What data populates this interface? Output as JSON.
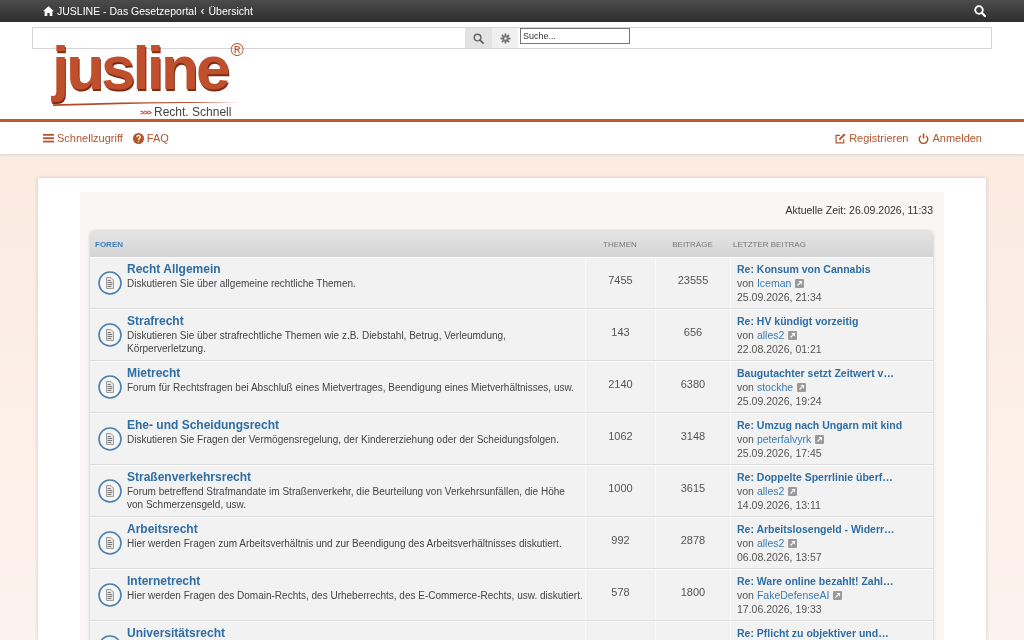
{
  "topbar": {
    "breadcrumbs": [
      {
        "label": "JUSLINE - Das Gesetzeportal"
      },
      {
        "label": "Übersicht"
      }
    ],
    "separator": "‹"
  },
  "search": {
    "placeholder": "Suche..."
  },
  "logo": {
    "wordmark": "jusline",
    "registered": "®",
    "tagline_arrows": ">>>",
    "tagline": "Recht. Schnell"
  },
  "navbar": {
    "quick_access": "Schnellzugriff",
    "faq": "FAQ",
    "register": "Registrieren",
    "login": "Anmelden"
  },
  "current_time": "Aktuelle Zeit: 26.09.2026, 11:33",
  "table": {
    "columns": [
      "FOREN",
      "THEMEN",
      "BEITRÄGE",
      "LETZTER BEITRAG"
    ],
    "rows": [
      {
        "title": "Recht Allgemein",
        "description": "Diskutieren Sie über allgemeine rechtliche Themen.",
        "topics": "7455",
        "posts": "23555",
        "last_post": {
          "title": "Re: Konsum von Cannabis",
          "by": "von",
          "author": "Iceman",
          "date": "25.09.2026, 21:34"
        }
      },
      {
        "title": "Strafrecht",
        "description": "Diskutieren Sie über strafrechtliche Themen wie z.B. Diebstahl, Betrug, Verleumdung, Körperverletzung.",
        "topics": "143",
        "posts": "656",
        "last_post": {
          "title": "Re: HV kündigt vorzeitig",
          "by": "von",
          "author": "alles2",
          "date": "22.08.2026, 01:21"
        }
      },
      {
        "title": "Mietrecht",
        "description": "Forum für Rechtsfragen bei Abschluß eines Mietvertrages, Beendigung eines Mietverhältnisses, usw.",
        "topics": "2140",
        "posts": "6380",
        "last_post": {
          "title": "Baugutachter setzt Zeitwert v…",
          "by": "von",
          "author": "stockhe",
          "date": "25.09.2026, 19:24"
        }
      },
      {
        "title": "Ehe- und Scheidungsrecht",
        "description": "Diskutieren Sie Fragen der Vermögensregelung, der Kindererziehung oder der Scheidungsfolgen.",
        "topics": "1062",
        "posts": "3148",
        "last_post": {
          "title": "Re: Umzug nach Ungarn mit kind",
          "by": "von",
          "author": "peterfalvyrk",
          "date": "25.09.2026, 17:45"
        }
      },
      {
        "title": "Straßenverkehrsrecht",
        "description": "Forum betreffend Strafmandate im Straßenverkehr, die Beurteilung von Verkehrsunfällen, die Höhe von Schmerzensgeld, usw.",
        "topics": "1000",
        "posts": "3615",
        "last_post": {
          "title": "Re: Doppelte Sperrlinie überf…",
          "by": "von",
          "author": "alles2",
          "date": "14.09.2026, 13:11"
        }
      },
      {
        "title": "Arbeitsrecht",
        "description": "Hier werden Fragen zum Arbeitsverhältnis und zur Beendigung des Arbeitsverhältnisses diskutiert.",
        "topics": "992",
        "posts": "2878",
        "last_post": {
          "title": "Re: Arbeitslosengeld - Widerr…",
          "by": "von",
          "author": "alles2",
          "date": "06.08.2026, 13:57"
        }
      },
      {
        "title": "Internetrecht",
        "description": "Hier werden Fragen des Domain-Rechts, des Urheberrechts, des E-Commerce-Rechts, usw. diskutiert.",
        "topics": "578",
        "posts": "1800",
        "last_post": {
          "title": "Re: Ware online bezahlt! Zahl…",
          "by": "von",
          "author": "FakeDefenseAI",
          "date": "17.06.2026, 19:33"
        }
      },
      {
        "title": "Universitätsrecht",
        "last_post": {
          "title": "Re: Pflicht zu objektiver und…"
        }
      }
    ]
  }
}
